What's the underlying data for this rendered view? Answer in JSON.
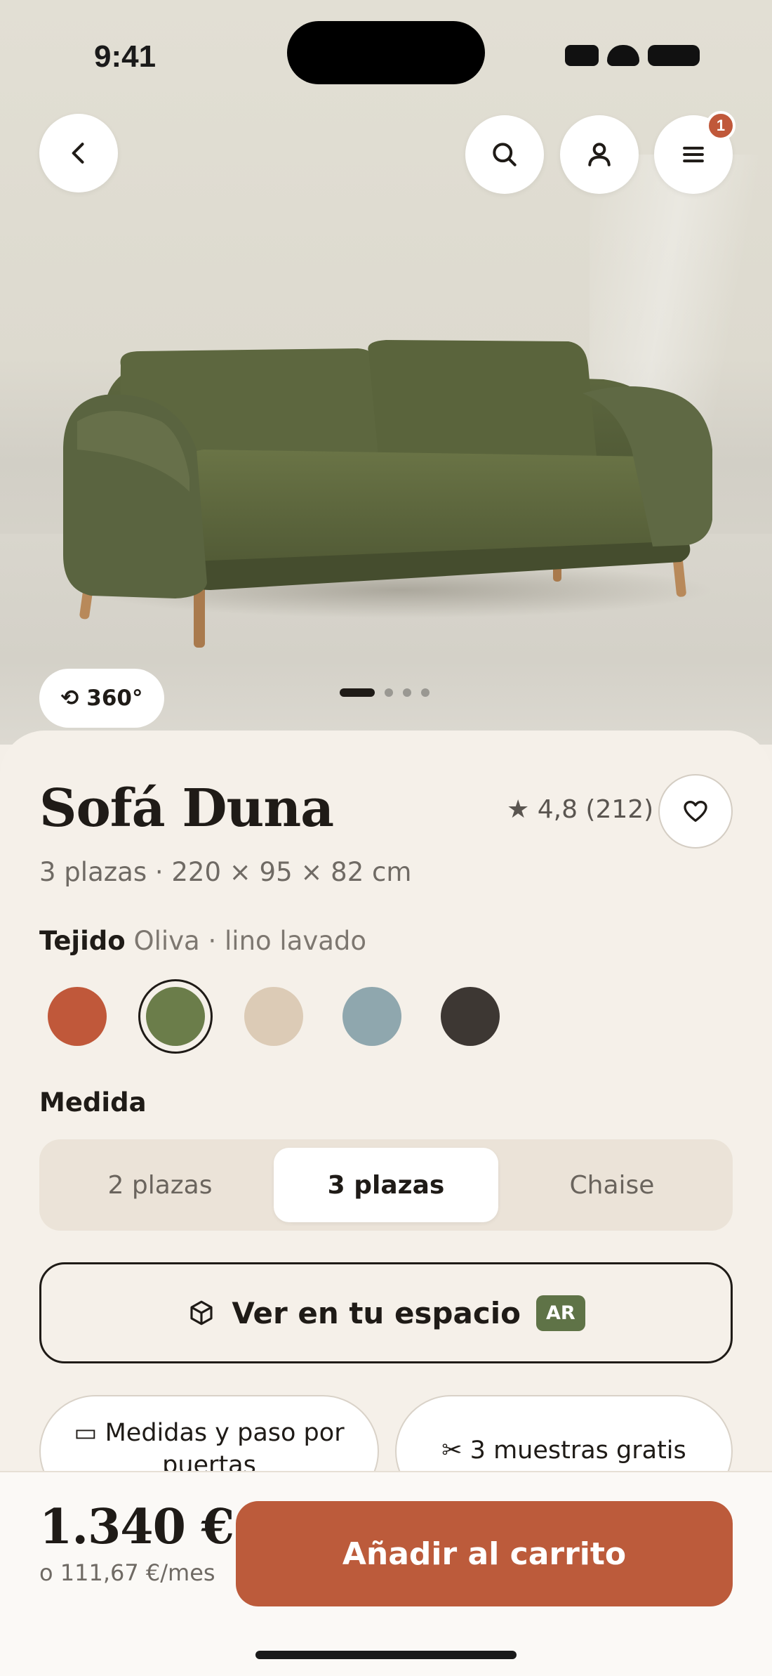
{
  "status_bar": {
    "time": "9:41"
  },
  "nav": {
    "cart_count": "1"
  },
  "gallery": {
    "view_360_label": "⟲ 360°",
    "pages": 4,
    "active_page": 1
  },
  "product": {
    "name": "Sofá Duna",
    "rating": "★ 4,8 (212)",
    "specs": "3 plazas · 220 × 95 × 82 cm"
  },
  "fabric": {
    "label": "Tejido",
    "selected_name": "Oliva · lino lavado",
    "swatches": [
      {
        "color": "#c0583a"
      },
      {
        "color": "#6b7d4a",
        "selected": true
      },
      {
        "color": "#dccbb6"
      },
      {
        "color": "#8fa7ae"
      },
      {
        "color": "#3d3733"
      }
    ]
  },
  "size": {
    "label": "Medida",
    "options": [
      "2 plazas",
      "3 plazas",
      "Chaise"
    ],
    "selected": "3 plazas"
  },
  "ar": {
    "label": "Ver en tu espacio",
    "tag": "AR"
  },
  "chips": {
    "dimensions": "▭ Medidas y paso por puertas",
    "samples": "✂ 3 muestras gratis"
  },
  "purchase": {
    "price": "1.340 €",
    "monthly": "o 111,67 €/mes",
    "add_to_cart": "Añadir al carrito"
  },
  "colors": {
    "accent": "#bc5b3b",
    "olive": "#5f7347",
    "sheet_bg": "#f5f0e9"
  }
}
